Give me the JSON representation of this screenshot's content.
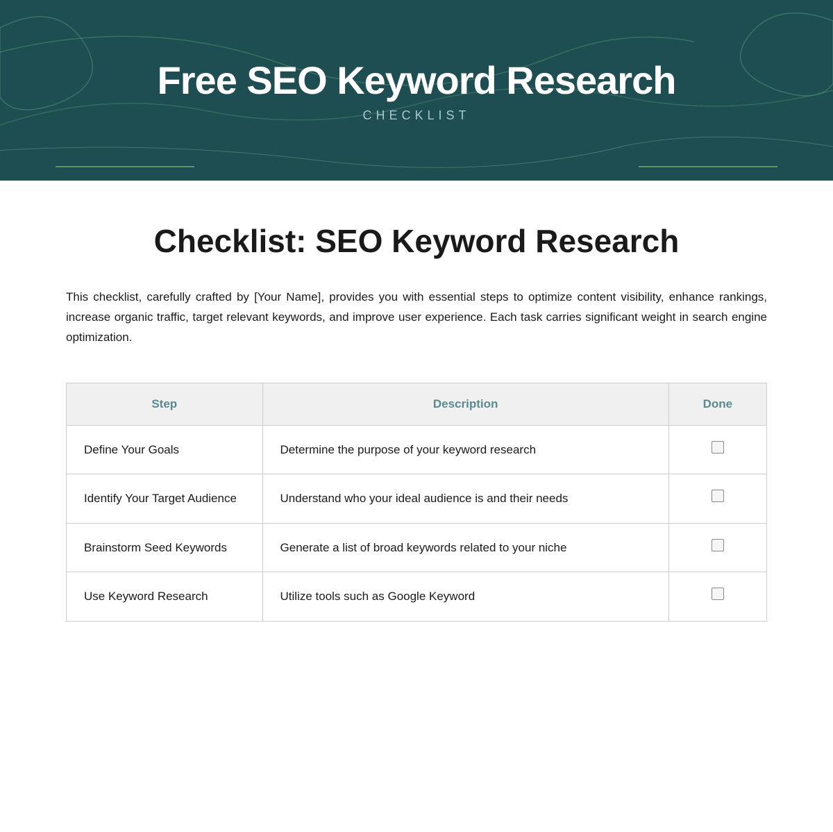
{
  "header": {
    "title": "Free SEO Keyword Research",
    "subtitle": "CHECKLIST",
    "bg_color": "#1e4d52"
  },
  "page_title": "Checklist: SEO Keyword Research",
  "description": "This checklist, carefully crafted by [Your Name], provides you with essential steps to optimize content visibility, enhance rankings, increase organic traffic, target relevant keywords, and improve user experience. Each task carries significant weight in search engine optimization.",
  "table": {
    "columns": [
      {
        "key": "step",
        "label": "Step"
      },
      {
        "key": "description",
        "label": "Description"
      },
      {
        "key": "done",
        "label": "Done"
      }
    ],
    "rows": [
      {
        "step": "Define Your Goals",
        "description": "Determine the purpose of your keyword research",
        "done": false
      },
      {
        "step": "Identify Your Target Audience",
        "description": "Understand who your ideal audience is and their needs",
        "done": false
      },
      {
        "step": "Brainstorm Seed Keywords",
        "description": "Generate a list of broad keywords related to your niche",
        "done": false
      },
      {
        "step": "Use Keyword Research",
        "description": "Utilize tools such as Google Keyword",
        "done": false
      }
    ]
  }
}
